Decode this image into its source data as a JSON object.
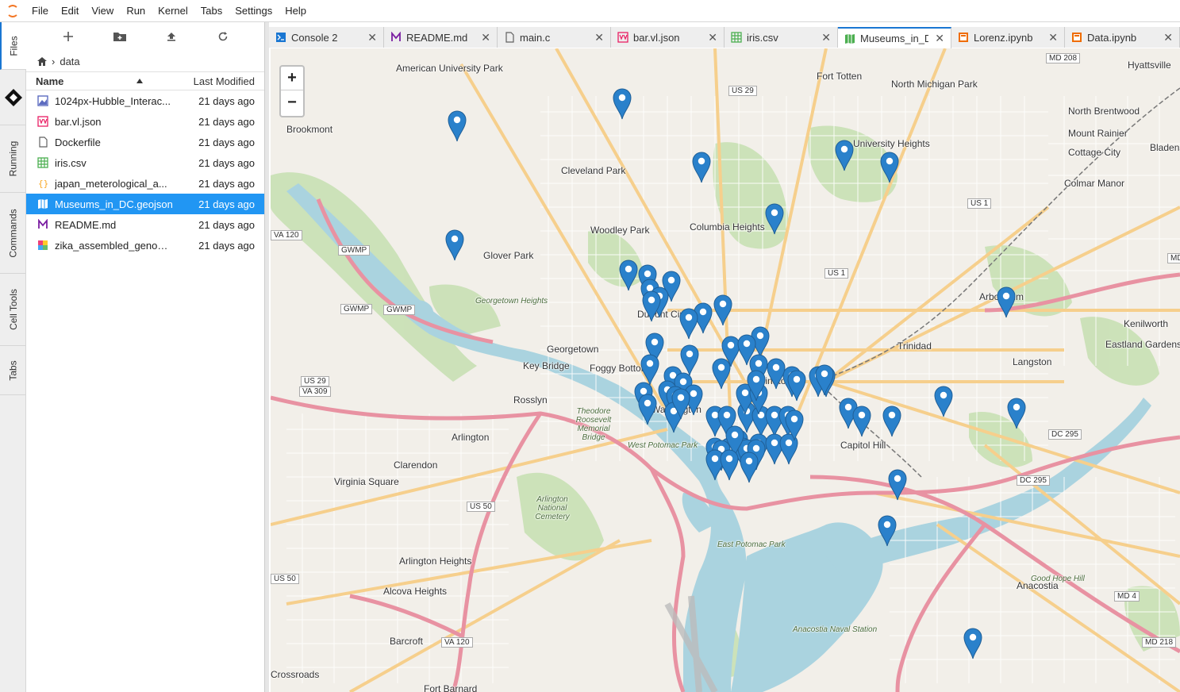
{
  "menu": [
    "File",
    "Edit",
    "View",
    "Run",
    "Kernel",
    "Tabs",
    "Settings",
    "Help"
  ],
  "sidebar_tabs": [
    "Files",
    "Running",
    "Commands",
    "Cell Tools",
    "Tabs"
  ],
  "filebrowser": {
    "breadcrumb": "data",
    "col_name": "Name",
    "col_modified": "Last Modified",
    "files": [
      {
        "name": "1024px-Hubble_Interac...",
        "modified": "21 days ago",
        "icon": "image-icon"
      },
      {
        "name": "bar.vl.json",
        "modified": "21 days ago",
        "icon": "vega-icon"
      },
      {
        "name": "Dockerfile",
        "modified": "21 days ago",
        "icon": "file-icon"
      },
      {
        "name": "iris.csv",
        "modified": "21 days ago",
        "icon": "csv-icon"
      },
      {
        "name": "japan_meterological_a...",
        "modified": "21 days ago",
        "icon": "json-icon"
      },
      {
        "name": "Museums_in_DC.geojson",
        "modified": "21 days ago",
        "icon": "geojson-icon",
        "selected": true
      },
      {
        "name": "README.md",
        "modified": "21 days ago",
        "icon": "markdown-icon"
      },
      {
        "name": "zika_assembled_genom...",
        "modified": "21 days ago",
        "icon": "fasta-icon"
      }
    ]
  },
  "tabs": [
    {
      "label": "Console 2",
      "icon": "console-icon"
    },
    {
      "label": "README.md",
      "icon": "markdown-icon"
    },
    {
      "label": "main.c",
      "icon": "file-icon"
    },
    {
      "label": "bar.vl.json",
      "icon": "vega-icon"
    },
    {
      "label": "iris.csv",
      "icon": "csv-icon"
    },
    {
      "label": "Museums_in_D",
      "icon": "geojson-icon",
      "active": true
    },
    {
      "label": "Lorenz.ipynb",
      "icon": "notebook-icon"
    },
    {
      "label": "Data.ipynb",
      "icon": "notebook-icon"
    }
  ],
  "map": {
    "zoom_in": "+",
    "zoom_out": "−",
    "labels": [
      "American University Park",
      "Fort Totten",
      "North Michigan Park",
      "Hyattsville",
      "Brookmont",
      "Cleveland Park",
      "University Heights",
      "North Brentwood",
      "Mount Rainier",
      "Cottage City",
      "Bladensburg",
      "Colmar Manor",
      "Woodley Park",
      "Columbia Heights",
      "Glover Park",
      "Arboretum",
      "Kenilworth",
      "Eastland Gardens",
      "Georgetown",
      "Foggy Bottom",
      "Trinidad",
      "Langston",
      "Rosslyn",
      "Chinatown",
      "Washington",
      "Capitol Hill",
      "Arlington",
      "Clarendon",
      "Virginia Square",
      "Arlington Heights",
      "Alcova Heights",
      "Anacostia",
      "Barcroft",
      "Fort Barnard",
      "Crossroads",
      "Key Bridge",
      "Dupont Circle",
      "Georgetown Heights",
      "Arlington National Cemetery",
      "Theodore Roosevelt Memorial Bridge",
      "East Potomac Park",
      "West Potomac Park",
      "Good Hope Hill",
      "Anacostia Naval Station"
    ],
    "road_shields": [
      "US 29",
      "US 1",
      "US 1",
      "GWMP",
      "GWMP",
      "GWMP",
      "VA 120",
      "US 29",
      "VA 309",
      "US 50",
      "US 50",
      "VA 120",
      "DC 295",
      "DC 295",
      "MD 208",
      "MD 4",
      "MD 218",
      "MD"
    ],
    "marker_count": 72
  }
}
